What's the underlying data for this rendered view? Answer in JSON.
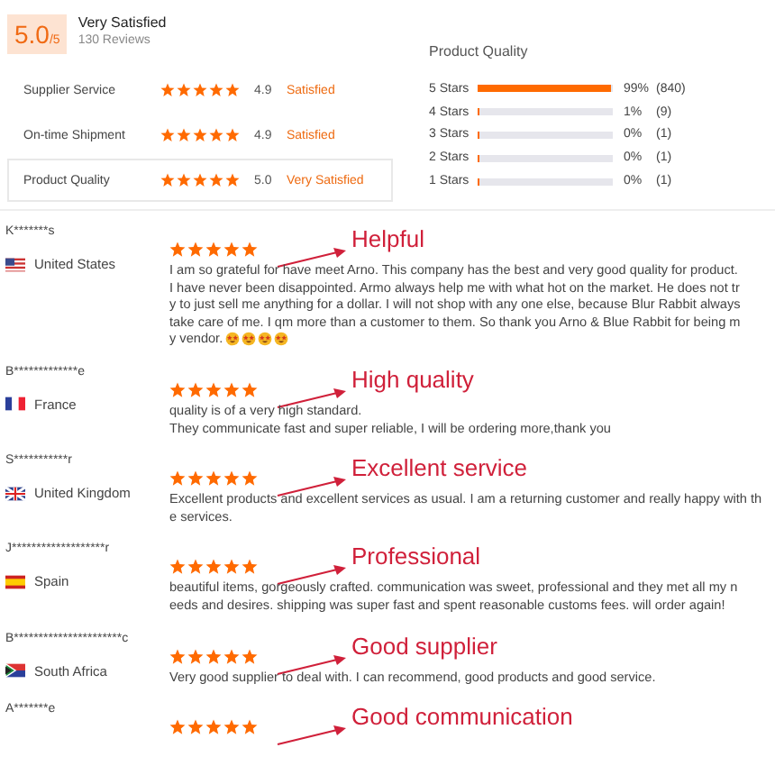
{
  "summary": {
    "score": "5.0",
    "out_of": "/5",
    "verdict": "Very Satisfied",
    "reviews": "130 Reviews",
    "ratings": [
      {
        "label": "Supplier Service",
        "stars": 5,
        "value": "4.9",
        "status": "Satisfied",
        "selected": false
      },
      {
        "label": "On-time Shipment",
        "stars": 5,
        "value": "4.9",
        "status": "Satisfied",
        "selected": false
      },
      {
        "label": "Product Quality",
        "stars": 5,
        "value": "5.0",
        "status": "Very Satisfied",
        "selected": true
      }
    ]
  },
  "distribution": {
    "title": "Product Quality",
    "rows": [
      {
        "label": "5 Stars",
        "level": 0.99,
        "percent": "99%",
        "count": "(840)"
      },
      {
        "label": "4 Stars",
        "level": 0.01,
        "percent": "1%",
        "count": "(9)"
      },
      {
        "label": "3 Stars",
        "level": 0,
        "percent": "0%",
        "count": "(1)"
      },
      {
        "label": "2 Stars",
        "level": 0,
        "percent": "0%",
        "count": "(1)"
      },
      {
        "label": "1 Stars",
        "level": 0,
        "percent": "0%",
        "count": "(1)"
      }
    ]
  },
  "reviews": [
    {
      "name": "K*******s",
      "country": "United States",
      "kind": "us",
      "stars": 5,
      "annotation": "Helpful",
      "lines": [
        "I am so grateful for have meet Arno. This company has the best and very good quality for product.",
        "I have never been disappointed. Armo always help me with what hot on the market. He does not tr",
        "y to just sell me anything for a dollar. I will not shop with any one else, because Blur Rabbit always",
        "take care of me. I qm more than a customer to them. So thank you Arno & Blue Rabbit for being m",
        "y vendor."
      ],
      "emojis": [
        {
          "kind": "star-eyes"
        },
        {
          "kind": "star-eyes"
        },
        {
          "kind": "star-eyes"
        },
        {
          "kind": "star-eyes"
        }
      ]
    },
    {
      "name": "B*************e",
      "country": "France",
      "kind": "fr",
      "stars": 5,
      "annotation": "High quality",
      "lines": [
        "quality is of a very high standard.",
        "They communicate fast and super reliable, I will be ordering more,thank you"
      ]
    },
    {
      "name": "S***********r",
      "country": "United Kingdom",
      "kind": "gb",
      "stars": 5,
      "annotation": "Excellent service",
      "lines": [
        "Excellent products and excellent services as usual. I am a returning customer and really happy with th",
        "e services."
      ]
    },
    {
      "name": "J*******************r",
      "country": "Spain",
      "kind": "es",
      "stars": 5,
      "annotation": "Professional",
      "lines": [
        "beautiful items, gorgeously crafted. communication was sweet, professional and they met all my n",
        "eeds and desires. shipping was super fast and spent reasonable customs fees. will order again!"
      ]
    },
    {
      "name": "B**********************c",
      "country": "South Africa",
      "kind": "za",
      "stars": 5,
      "annotation": "Good supplier",
      "lines": [
        "Very good supplier to deal with. I can recommend, good products and good service."
      ]
    },
    {
      "name": "A*******e",
      "stars": 5,
      "annotation": "Good communication"
    }
  ]
}
